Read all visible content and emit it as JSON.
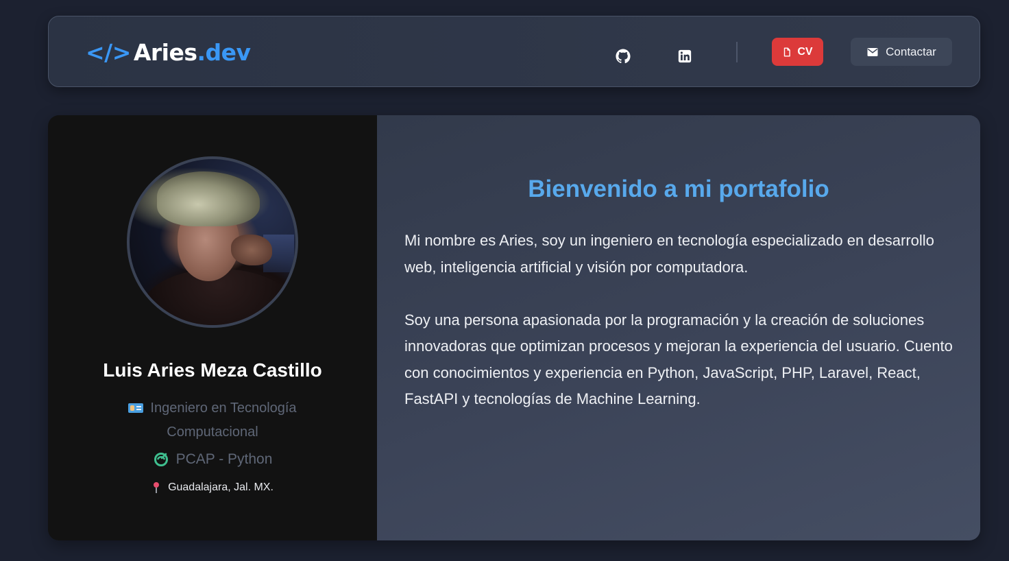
{
  "header": {
    "logo": {
      "bracket": "</>",
      "name": "Aries",
      "tld": ".dev"
    },
    "social": [
      {
        "name": "github",
        "icon": "github-icon"
      },
      {
        "name": "linkedin",
        "icon": "linkedin-icon"
      }
    ],
    "cv_label": "CV",
    "contact_label": "Contactar",
    "colors": {
      "accent": "#3a97f5",
      "cv": "#dc3a3a"
    }
  },
  "profile": {
    "full_name": "Luis Aries Meza Castillo",
    "title": "Ingeniero en Tecnología Computacional",
    "certification": "PCAP - Python",
    "location": "Guadalajara, Jal. MX."
  },
  "about": {
    "heading": "Bienvenido a mi portafolio",
    "paragraph_1": "Mi nombre es Aries, soy un ingeniero en tecnología especializado en desarrollo web, inteligencia artificial y visión por computadora.",
    "paragraph_2": "Soy una persona apasionada por la programación y la creación de soluciones innovadoras que optimizan procesos y mejoran la experiencia del usuario. Cuento con conocimientos y experiencia en Python, JavaScript, PHP, Laravel, React, FastAPI y tecnologías de Machine Learning.",
    "heading_color": "#58a9ec"
  }
}
